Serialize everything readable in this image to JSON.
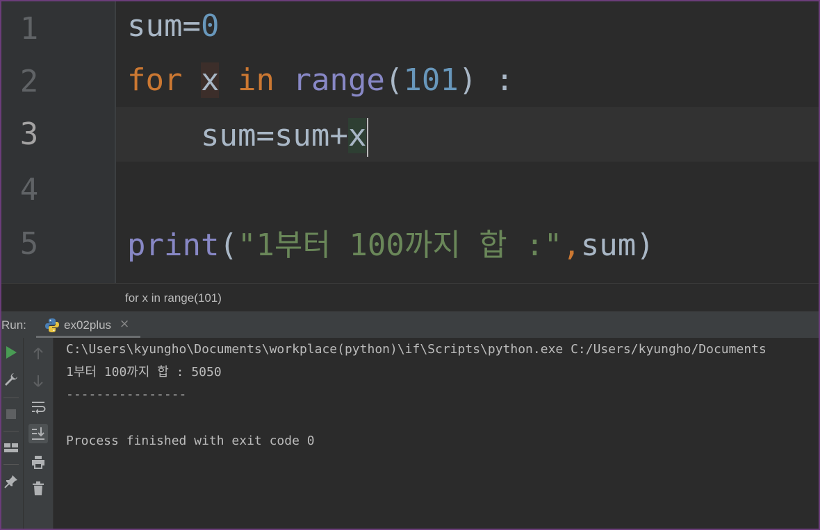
{
  "editor": {
    "line_numbers": [
      "1",
      "2",
      "3",
      "4",
      "5"
    ],
    "current_line": 3,
    "lines": {
      "l1": {
        "ident": "sum",
        "op": "=",
        "num": "0"
      },
      "l2": {
        "kw_for": "for",
        "sp1": " ",
        "var": "x",
        "sp2": " ",
        "kw_in": "in",
        "sp3": " ",
        "builtin": "range",
        "lparen": "(",
        "num": "101",
        "rparen": ")",
        "tail": " :"
      },
      "l3": {
        "indent": "    ",
        "target": "sum",
        "op": "=sum+",
        "var": "x"
      },
      "l5": {
        "builtin": "print",
        "lparen": "(",
        "string": "\"1부터 100까지 합 :\"",
        "comma": ",",
        "arg": "sum",
        "rparen": ")"
      }
    }
  },
  "breadcrumb": {
    "text": "for x in range(101)"
  },
  "run": {
    "label": "Run:",
    "tab_label": "ex02plus",
    "tab_close": "×",
    "console_lines": [
      "C:\\Users\\kyungho\\Documents\\workplace(python)\\if\\Scripts\\python.exe C:/Users/kyungho/Documents",
      "1부터 100까지 합 : 5050",
      "----------------",
      "",
      "Process finished with exit code 0"
    ]
  },
  "colors": {
    "keyword": "#cc7832",
    "builtin": "#8888c6",
    "number": "#6897bb",
    "string": "#6a8759",
    "identifier": "#a9b7c6",
    "run_green": "#499c54"
  },
  "icons": {
    "run": "play-icon",
    "rerun": "wrench-icon",
    "stop": "stop-icon",
    "layout": "layout-icon",
    "pin": "pin-icon",
    "up": "arrow-up-icon",
    "down": "arrow-down-icon",
    "wrap": "soft-wrap-icon",
    "scroll_end": "scroll-to-end-icon",
    "print": "print-icon",
    "trash": "trash-icon"
  }
}
